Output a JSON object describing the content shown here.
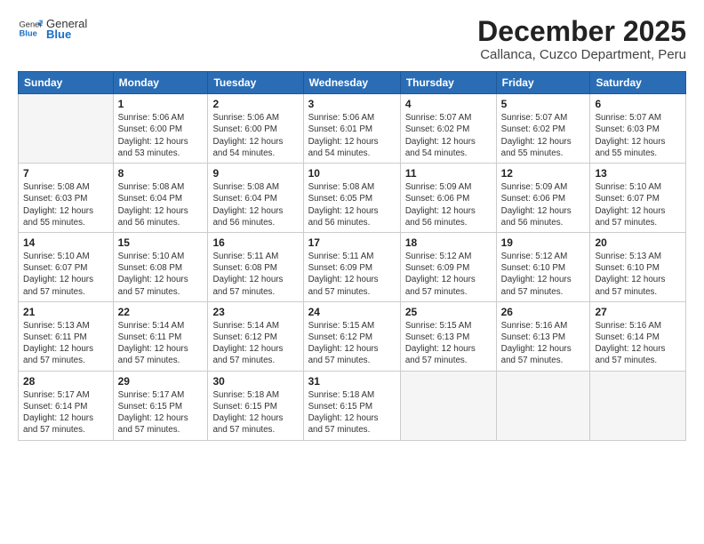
{
  "logo": {
    "general": "General",
    "blue": "Blue"
  },
  "header": {
    "title": "December 2025",
    "subtitle": "Callanca, Cuzco Department, Peru"
  },
  "days_of_week": [
    "Sunday",
    "Monday",
    "Tuesday",
    "Wednesday",
    "Thursday",
    "Friday",
    "Saturday"
  ],
  "weeks": [
    [
      {
        "day": "",
        "info": ""
      },
      {
        "day": "1",
        "info": "Sunrise: 5:06 AM\nSunset: 6:00 PM\nDaylight: 12 hours\nand 53 minutes."
      },
      {
        "day": "2",
        "info": "Sunrise: 5:06 AM\nSunset: 6:00 PM\nDaylight: 12 hours\nand 54 minutes."
      },
      {
        "day": "3",
        "info": "Sunrise: 5:06 AM\nSunset: 6:01 PM\nDaylight: 12 hours\nand 54 minutes."
      },
      {
        "day": "4",
        "info": "Sunrise: 5:07 AM\nSunset: 6:02 PM\nDaylight: 12 hours\nand 54 minutes."
      },
      {
        "day": "5",
        "info": "Sunrise: 5:07 AM\nSunset: 6:02 PM\nDaylight: 12 hours\nand 55 minutes."
      },
      {
        "day": "6",
        "info": "Sunrise: 5:07 AM\nSunset: 6:03 PM\nDaylight: 12 hours\nand 55 minutes."
      }
    ],
    [
      {
        "day": "7",
        "info": "Sunrise: 5:08 AM\nSunset: 6:03 PM\nDaylight: 12 hours\nand 55 minutes."
      },
      {
        "day": "8",
        "info": "Sunrise: 5:08 AM\nSunset: 6:04 PM\nDaylight: 12 hours\nand 56 minutes."
      },
      {
        "day": "9",
        "info": "Sunrise: 5:08 AM\nSunset: 6:04 PM\nDaylight: 12 hours\nand 56 minutes."
      },
      {
        "day": "10",
        "info": "Sunrise: 5:08 AM\nSunset: 6:05 PM\nDaylight: 12 hours\nand 56 minutes."
      },
      {
        "day": "11",
        "info": "Sunrise: 5:09 AM\nSunset: 6:06 PM\nDaylight: 12 hours\nand 56 minutes."
      },
      {
        "day": "12",
        "info": "Sunrise: 5:09 AM\nSunset: 6:06 PM\nDaylight: 12 hours\nand 56 minutes."
      },
      {
        "day": "13",
        "info": "Sunrise: 5:10 AM\nSunset: 6:07 PM\nDaylight: 12 hours\nand 57 minutes."
      }
    ],
    [
      {
        "day": "14",
        "info": "Sunrise: 5:10 AM\nSunset: 6:07 PM\nDaylight: 12 hours\nand 57 minutes."
      },
      {
        "day": "15",
        "info": "Sunrise: 5:10 AM\nSunset: 6:08 PM\nDaylight: 12 hours\nand 57 minutes."
      },
      {
        "day": "16",
        "info": "Sunrise: 5:11 AM\nSunset: 6:08 PM\nDaylight: 12 hours\nand 57 minutes."
      },
      {
        "day": "17",
        "info": "Sunrise: 5:11 AM\nSunset: 6:09 PM\nDaylight: 12 hours\nand 57 minutes."
      },
      {
        "day": "18",
        "info": "Sunrise: 5:12 AM\nSunset: 6:09 PM\nDaylight: 12 hours\nand 57 minutes."
      },
      {
        "day": "19",
        "info": "Sunrise: 5:12 AM\nSunset: 6:10 PM\nDaylight: 12 hours\nand 57 minutes."
      },
      {
        "day": "20",
        "info": "Sunrise: 5:13 AM\nSunset: 6:10 PM\nDaylight: 12 hours\nand 57 minutes."
      }
    ],
    [
      {
        "day": "21",
        "info": "Sunrise: 5:13 AM\nSunset: 6:11 PM\nDaylight: 12 hours\nand 57 minutes."
      },
      {
        "day": "22",
        "info": "Sunrise: 5:14 AM\nSunset: 6:11 PM\nDaylight: 12 hours\nand 57 minutes."
      },
      {
        "day": "23",
        "info": "Sunrise: 5:14 AM\nSunset: 6:12 PM\nDaylight: 12 hours\nand 57 minutes."
      },
      {
        "day": "24",
        "info": "Sunrise: 5:15 AM\nSunset: 6:12 PM\nDaylight: 12 hours\nand 57 minutes."
      },
      {
        "day": "25",
        "info": "Sunrise: 5:15 AM\nSunset: 6:13 PM\nDaylight: 12 hours\nand 57 minutes."
      },
      {
        "day": "26",
        "info": "Sunrise: 5:16 AM\nSunset: 6:13 PM\nDaylight: 12 hours\nand 57 minutes."
      },
      {
        "day": "27",
        "info": "Sunrise: 5:16 AM\nSunset: 6:14 PM\nDaylight: 12 hours\nand 57 minutes."
      }
    ],
    [
      {
        "day": "28",
        "info": "Sunrise: 5:17 AM\nSunset: 6:14 PM\nDaylight: 12 hours\nand 57 minutes."
      },
      {
        "day": "29",
        "info": "Sunrise: 5:17 AM\nSunset: 6:15 PM\nDaylight: 12 hours\nand 57 minutes."
      },
      {
        "day": "30",
        "info": "Sunrise: 5:18 AM\nSunset: 6:15 PM\nDaylight: 12 hours\nand 57 minutes."
      },
      {
        "day": "31",
        "info": "Sunrise: 5:18 AM\nSunset: 6:15 PM\nDaylight: 12 hours\nand 57 minutes."
      },
      {
        "day": "",
        "info": ""
      },
      {
        "day": "",
        "info": ""
      },
      {
        "day": "",
        "info": ""
      }
    ]
  ]
}
